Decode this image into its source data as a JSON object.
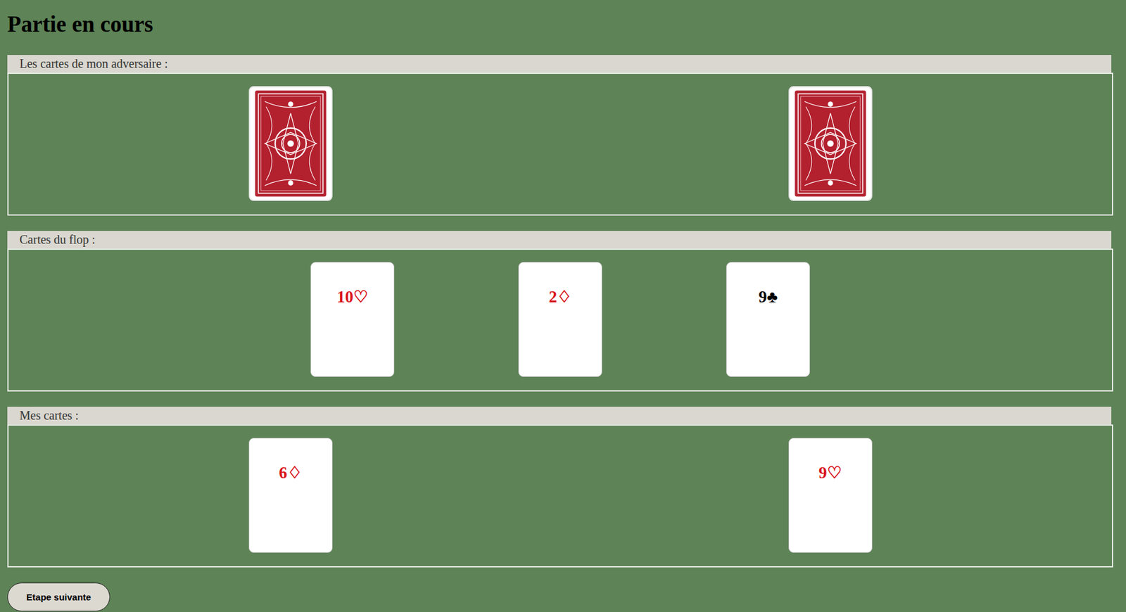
{
  "title": "Partie en cours",
  "sections": [
    {
      "legend": "Les cartes de mon adversaire :",
      "kind": "hand",
      "cards": [
        {
          "face_up": false
        },
        {
          "face_up": false
        }
      ]
    },
    {
      "legend": "Cartes du flop :",
      "kind": "flop",
      "cards": [
        {
          "face_up": true,
          "label": "10♡",
          "color": "#d9141c"
        },
        {
          "face_up": true,
          "label": "2♢",
          "color": "#d9141c"
        },
        {
          "face_up": true,
          "label": "9♣",
          "color": "#000000"
        }
      ]
    },
    {
      "legend": "Mes cartes :",
      "kind": "hand",
      "cards": [
        {
          "face_up": true,
          "label": "6♢",
          "color": "#d9141c"
        },
        {
          "face_up": true,
          "label": "9♡",
          "color": "#d9141c"
        }
      ]
    }
  ],
  "button": {
    "label": "Etape suivante"
  }
}
